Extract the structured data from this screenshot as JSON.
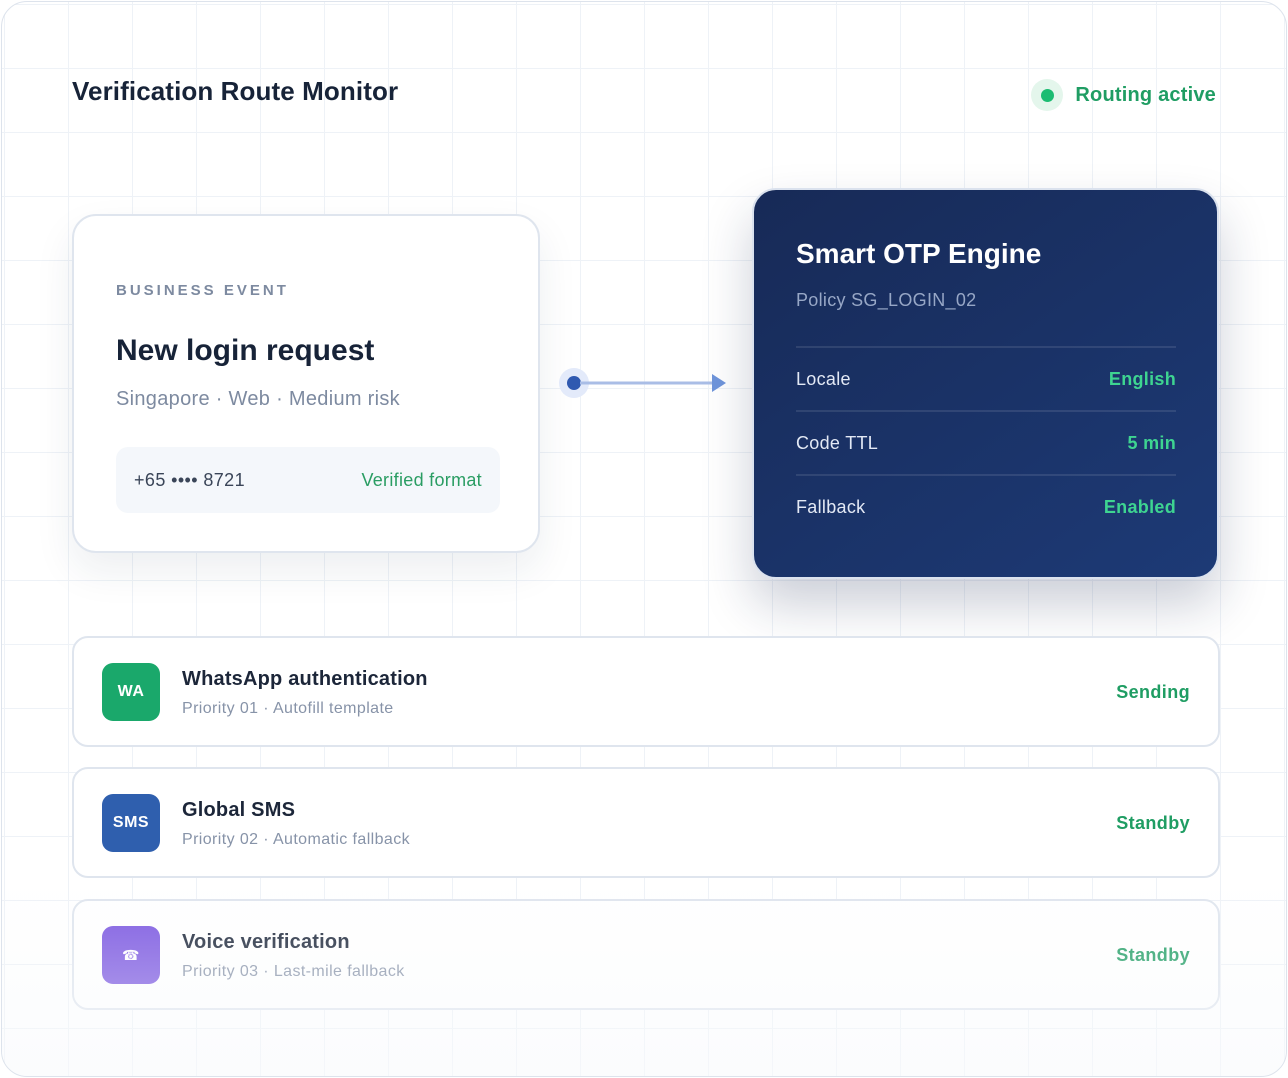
{
  "header": {
    "title": "Verification Route Monitor",
    "status": "Routing active"
  },
  "event": {
    "eyebrow": "BUSINESS EVENT",
    "title": "New login request",
    "meta": "Singapore · Web · Medium risk",
    "phone": "+65 •••• 8721",
    "phone_status": "Verified format"
  },
  "engine": {
    "title": "Smart OTP Engine",
    "policy": "Policy SG_LOGIN_02",
    "rows": [
      {
        "label": "Locale",
        "value": "English"
      },
      {
        "label": "Code TTL",
        "value": "5 min"
      },
      {
        "label": "Fallback",
        "value": "Enabled"
      }
    ]
  },
  "channels": [
    {
      "badge": "WA",
      "name": "WhatsApp authentication",
      "desc": "Priority 01 · Autofill template",
      "state": "Sending",
      "color": "#1aa86b",
      "icon": "whatsapp-icon"
    },
    {
      "badge": "SMS",
      "name": "Global SMS",
      "desc": "Priority 02 · Automatic fallback",
      "state": "Standby",
      "color": "#2f5fae",
      "icon": "sms-icon"
    },
    {
      "badge": "☎",
      "name": "Voice verification",
      "desc": "Priority 03 · Last-mile fallback",
      "state": "Standby",
      "color": "#7b57e0",
      "icon": "phone-icon"
    }
  ],
  "colors": {
    "accent_green": "#1f9d63",
    "engine_bg": "#1a3366",
    "connector": "#6f95db"
  }
}
